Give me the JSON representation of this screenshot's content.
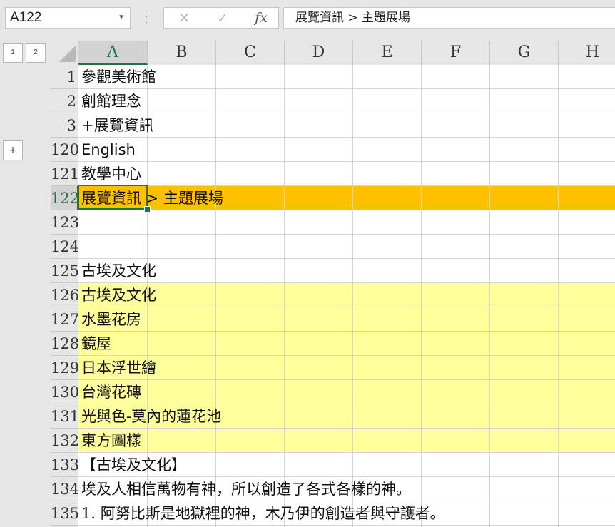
{
  "formula_bar": {
    "name_box": "A122",
    "cancel_icon": "✕",
    "enter_icon": "✓",
    "fx_label": "fx",
    "formula": "展覽資訊 > 主題展場"
  },
  "outline": {
    "level1": "1",
    "level2": "2",
    "expand": "+"
  },
  "columns": [
    "A",
    "B",
    "C",
    "D",
    "E",
    "F",
    "G",
    "H"
  ],
  "selected_column": "A",
  "rows": [
    {
      "num": "120",
      "text": ""
    },
    {
      "num": "1",
      "text": "參觀美術館"
    },
    {
      "num": "2",
      "text": "創館理念"
    },
    {
      "num": "3",
      "text": "+展覽資訊"
    },
    {
      "num": "120",
      "text": "English"
    },
    {
      "num": "121",
      "text": "教學中心"
    },
    {
      "num": "122",
      "text": "展覽資訊 > 主題展場"
    },
    {
      "num": "123",
      "text": ""
    },
    {
      "num": "124",
      "text": ""
    },
    {
      "num": "125",
      "text": "古埃及文化"
    },
    {
      "num": "126",
      "text": "古埃及文化"
    },
    {
      "num": "127",
      "text": "水墨花房"
    },
    {
      "num": "128",
      "text": "鏡屋"
    },
    {
      "num": "129",
      "text": "日本浮世繪"
    },
    {
      "num": "130",
      "text": "台灣花磚"
    },
    {
      "num": "131",
      "text": "光與色-莫內的蓮花池"
    },
    {
      "num": "132",
      "text": "東方圖樣"
    },
    {
      "num": "133",
      "text": "【古埃及文化】"
    },
    {
      "num": "134",
      "text": "埃及人相信萬物有神，所以創造了各式各樣的神。"
    },
    {
      "num": "135",
      "text": "1.  阿努比斯是地獄裡的神，木乃伊的創造者與守護者。"
    }
  ],
  "colors": {
    "selection": "#217346",
    "highlight_orange": "#ffc000",
    "highlight_yellow": "#ffff9c"
  }
}
